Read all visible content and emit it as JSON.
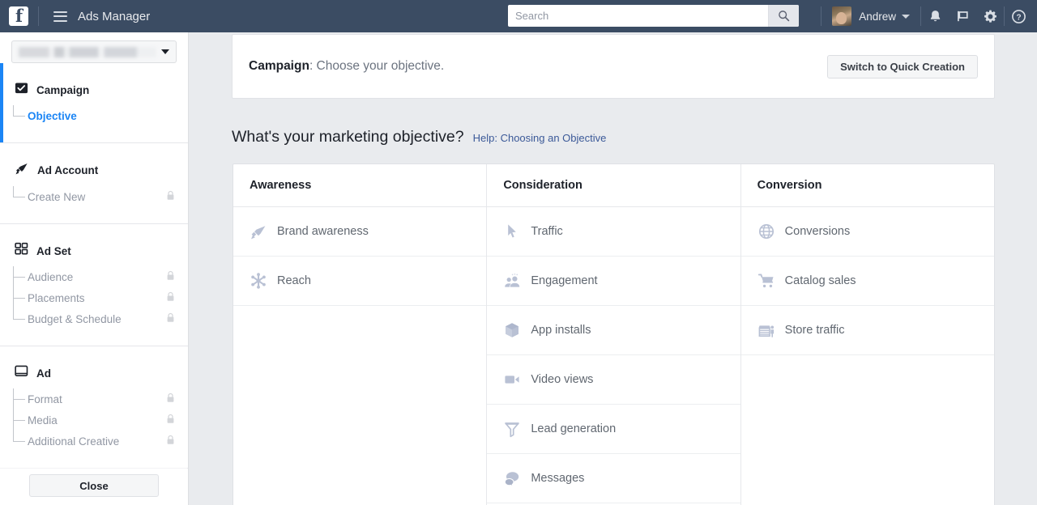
{
  "topbar": {
    "logo": "facebook-logo",
    "menu_icon": "hamburger-menu-icon",
    "app_title": "Ads Manager",
    "search": {
      "value": "",
      "placeholder": "Search",
      "button_icon": "search-icon"
    },
    "user": {
      "name": "Andrew",
      "avatar": "user-avatar",
      "caret": "chevron-down-icon"
    },
    "icons": [
      {
        "name": "notifications-bell-icon",
        "glyph": "bell"
      },
      {
        "name": "flag-icon",
        "glyph": "flag"
      },
      {
        "name": "settings-gear-icon",
        "glyph": "gear"
      },
      {
        "name": "help-icon",
        "glyph": "question"
      }
    ]
  },
  "sidebar": {
    "account_selector": {
      "value": "",
      "redacted": true,
      "caret": "chevron-down-icon"
    },
    "sections": [
      {
        "label": "Campaign",
        "icon": "checkbox-checked-icon",
        "active": true,
        "items": [
          {
            "label": "Objective",
            "selected": true,
            "locked": false
          }
        ]
      },
      {
        "label": "Ad Account",
        "icon": "megaphone-icon",
        "active": false,
        "items": [
          {
            "label": "Create New",
            "selected": false,
            "locked": true
          }
        ]
      },
      {
        "label": "Ad Set",
        "icon": "grid-squares-icon",
        "active": false,
        "items": [
          {
            "label": "Audience",
            "selected": false,
            "locked": true
          },
          {
            "label": "Placements",
            "selected": false,
            "locked": true
          },
          {
            "label": "Budget & Schedule",
            "selected": false,
            "locked": true
          }
        ]
      },
      {
        "label": "Ad",
        "icon": "ad-window-icon",
        "active": false,
        "items": [
          {
            "label": "Format",
            "selected": false,
            "locked": true
          },
          {
            "label": "Media",
            "selected": false,
            "locked": true
          },
          {
            "label": "Additional Creative",
            "selected": false,
            "locked": true
          }
        ]
      }
    ],
    "close_label": "Close"
  },
  "main": {
    "campaign_bar": {
      "label_bold": "Campaign",
      "label_rest": ": Choose your objective.",
      "quick_creation_label": "Switch to Quick Creation"
    },
    "objective_heading": "What's your marketing objective?",
    "objective_help_link": "Help: Choosing an Objective",
    "columns": [
      {
        "header": "Awareness",
        "items": [
          {
            "label": "Brand awareness",
            "icon": "megaphone-icon"
          },
          {
            "label": "Reach",
            "icon": "reach-starburst-icon"
          }
        ]
      },
      {
        "header": "Consideration",
        "items": [
          {
            "label": "Traffic",
            "icon": "cursor-arrow-icon"
          },
          {
            "label": "Engagement",
            "icon": "people-icon"
          },
          {
            "label": "App installs",
            "icon": "cube-box-icon"
          },
          {
            "label": "Video views",
            "icon": "video-camera-icon"
          },
          {
            "label": "Lead generation",
            "icon": "funnel-icon"
          },
          {
            "label": "Messages",
            "icon": "speech-bubbles-icon"
          }
        ]
      },
      {
        "header": "Conversion",
        "items": [
          {
            "label": "Conversions",
            "icon": "globe-icon"
          },
          {
            "label": "Catalog sales",
            "icon": "shopping-cart-icon"
          },
          {
            "label": "Store traffic",
            "icon": "storefront-icon"
          }
        ]
      }
    ]
  },
  "colors": {
    "topbar_bg": "#3b4c63",
    "page_bg": "#e9ebee",
    "accent_blue": "#1b85f5",
    "link_blue": "#3b5998",
    "objective_icon": "#b9c1d4",
    "muted_text": "#9197a3"
  }
}
